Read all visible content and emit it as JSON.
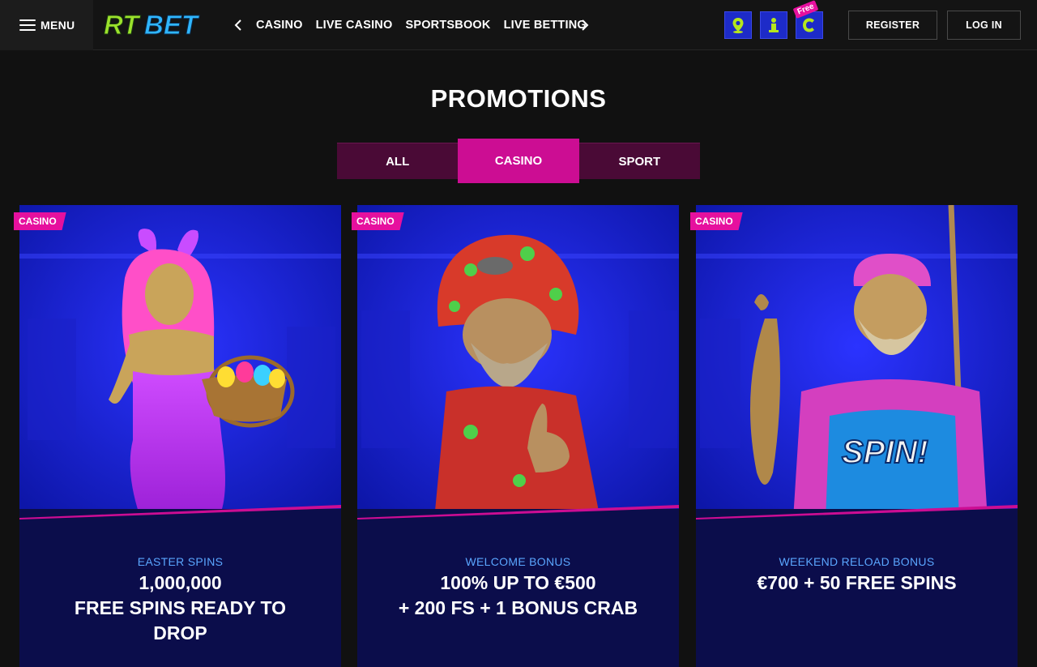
{
  "header": {
    "menu_label": "MENU",
    "logo_text": "RTBET",
    "nav": [
      "CASINO",
      "LIVE CASINO",
      "SPORTSBOOK",
      "LIVE BETTING"
    ],
    "free_tag": "Free",
    "register_label": "REGISTER",
    "login_label": "LOG IN"
  },
  "page": {
    "title": "PROMOTIONS",
    "tabs": [
      "ALL",
      "CASINO",
      "SPORT"
    ],
    "active_tab": "CASINO"
  },
  "cards": [
    {
      "badge": "CASINO",
      "subtitle": "EASTER SPINS",
      "headline": "1,000,000\nFREE SPINS READY TO\nDROP",
      "image": "easter-bunny-girl"
    },
    {
      "badge": "CASINO",
      "subtitle": "WELCOME BONUS",
      "headline": "100% UP TO €500\n+ 200 FS + 1 BONUS CRAB",
      "image": "gnome-character"
    },
    {
      "badge": "CASINO",
      "subtitle": "WEEKEND RELOAD BONUS",
      "headline": "€700 + 50 FREE SPINS",
      "image": "fisherman-character"
    }
  ],
  "colors": {
    "accent": "#cc0d93",
    "tab_inactive": "#4a0a36",
    "card_bg": "#0b0d4b",
    "subtitle": "#5aa6ff",
    "logo_green": "#9be22c",
    "logo_blue": "#2fb6ff"
  }
}
